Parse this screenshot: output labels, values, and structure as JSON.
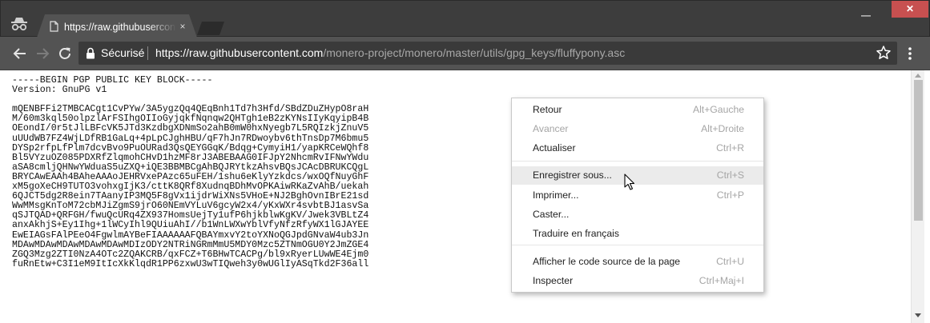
{
  "window": {
    "tab": {
      "title": "https://raw.githubusercontent.com/monero-project/monero/master/utils/gpg_keys/fluffypony.asc",
      "close_glyph": "×"
    },
    "minimize_glyph": "—",
    "close_glyph": "✕"
  },
  "toolbar": {
    "security_label": "Sécurisé",
    "url_host": "https://raw.githubusercontent.com",
    "url_path": "/monero-project/monero/master/utils/gpg_keys/fluffypony.asc",
    "icons": [
      "back-arrow-icon",
      "forward-arrow-icon",
      "reload-icon",
      "lock-icon",
      "star-icon",
      "kebab-menu-icon"
    ]
  },
  "document": {
    "lines": [
      "-----BEGIN PGP PUBLIC KEY BLOCK-----",
      "Version: GnuPG v1",
      "",
      "mQENBFFi2TMBCACgt1CvPYw/3A5ygzQq4QEqBnh1Td7h3Hfd/SBdZDuZHypO8raH",
      "M/60m3kql50olpzlArFSIhgOIIoGyjqkfNqnqw2QHTgh1eB2zKYNsIIyKqyipB4B",
      "OEondI/0r5tJlLBFcVK5JTd3KzdbgXDNmSo2ahB0mW0hxNyegb7L5RQIzkjZnuV5",
      "uUUdWB7FZ4WjLDfRB1GaLq+4pLpCJghHBU/qF7hJn7RDwoybv6thTnsDp7M6bmu5",
      "DYSp2rfpLfPlm7dcvBvo9PuOURad3QsQEYGGqK/Bdqg+CymyiH1/yapKRCeWQhf8",
      "Bl5VYzuOZ085PDXRfZlqmohCHvD1hzMF8rJ3ABEBAAG0IFJpY2NhcmRvIFNwYWdu",
      "aSA8cmljQHNwYWduaS5uZXQ+iQE3BBMBCgAhBQJRYtkzAhsvBQsJCAcDBRUKCQgL",
      "BRYCAwEAAh4BAheAAAoJEHRVxePAzc65uFEH/1shu6eKlyYzkdcs/wxOQfNuyGhF",
      "xM5goXeCH9TUTO3vohxgIjK3/cttK8QRf8XudnqBDhMvOPKAiwRKaZvAhB/uekah",
      "6QJCT5dg2R8ein7TAanyIP3MQ5F8gVx1ijdrWiXNs5VHoE+NJ2BghOvnIBrE21sd",
      "WwMMsgKnToM72cbMJiZgmS9jrO60NEmVYLuV6gcyW2x4/yKxWXr4svbtBJ1asvSa",
      "qSJTQAD+QRFGH/fwuQcURq4ZX937HomsUejTy1ufP6hjkblwKgKV/Jwek3VBLtZ4",
      "anxAkhjS+Ey1Ihg+1lWCyIhl9QUiuAhI//b1WnLWXwYblVfyNfzRfyWX1lGJAYEE",
      "EwEIAGsFAlPEeO4FgwlmAYBeFIAAAAAAFQBAYmxvY2toYXNoQGJpdGNvaW4ub3Jn",
      "MDAwMDAwMDAwMDAwMDAwMDIzODY2NTRiNGRmMmU5MDY0Mzc5ZTNmOGU0Y2JmZGE4",
      "ZGQ3Mzg2ZTI0NzA4OTc2ZQAKCRB/qxFCZ+T6BHwTCACPg/bl9xRyerLUwWE4Ejm0",
      "fuRnEtw+C3I1eM9ItIcXkKlqdR1PP6zxwU3wTIQweh3y0wUGlIyASqTkd2F36all"
    ]
  },
  "context_menu": {
    "items": [
      {
        "label": "Retour",
        "shortcut": "Alt+Gauche",
        "disabled": false
      },
      {
        "label": "Avancer",
        "shortcut": "Alt+Droite",
        "disabled": true
      },
      {
        "label": "Actualiser",
        "shortcut": "Ctrl+R",
        "disabled": false
      },
      {
        "label": "Enregistrer sous...",
        "shortcut": "Ctrl+S",
        "disabled": false,
        "hovered": true
      },
      {
        "label": "Imprimer...",
        "shortcut": "Ctrl+P",
        "disabled": false
      },
      {
        "label": "Caster...",
        "shortcut": "",
        "disabled": false
      },
      {
        "label": "Traduire en français",
        "shortcut": "",
        "disabled": false
      },
      {
        "label": "Afficher le code source de la page",
        "shortcut": "Ctrl+U",
        "disabled": false
      },
      {
        "label": "Inspecter",
        "shortcut": "Ctrl+Maj+I",
        "disabled": false
      }
    ]
  },
  "colors": {
    "frame": "#3d3d3d",
    "toolbar": "#535353",
    "omnibox": "#3a3a3a",
    "close_button": "#c75050",
    "menu_hover": "#ebebeb"
  }
}
